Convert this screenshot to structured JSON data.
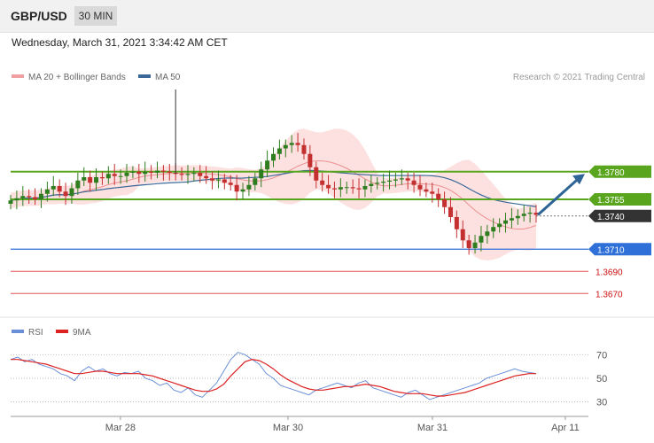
{
  "header": {
    "pair": "GBP/USD",
    "timeframe": "30 MIN",
    "datetime": "Wednesday, March 31, 2021 3:34:42 AM CET"
  },
  "legend": {
    "ma20": {
      "label": "MA 20 + Bollinger Bands",
      "color": "#f0a0a0"
    },
    "ma50": {
      "label": "MA 50",
      "color": "#3a6898"
    },
    "credit": "Research © 2021 Trading Central"
  },
  "rsi_legend": {
    "rsi": {
      "label": "RSI",
      "color": "#6a8fd8"
    },
    "ma9": {
      "label": "9MA",
      "color": "#dd2222"
    }
  },
  "colors": {
    "candle_up": "#2e7d1e",
    "candle_down": "#c43030",
    "band_fill": "#fde1e1",
    "resistance": "#5aa51e",
    "pivot": "#2e6fd8",
    "support": "#e05555",
    "arrow": "#2e6596",
    "current": "#333333"
  },
  "chart_data": [
    {
      "type": "candlestick",
      "title": "GBP/USD 30 MIN",
      "ylim": [
        1.3655,
        1.3855
      ],
      "x_ticks": [
        "Mar 28",
        "Mar 30",
        "Mar 31",
        "Apr 11"
      ],
      "x_tick_pos": [
        0.19,
        0.48,
        0.73,
        0.96
      ],
      "candles_estimated": [
        1.3754,
        1.3756,
        1.3758,
        1.3757,
        1.3755,
        1.376,
        1.3764,
        1.3767,
        1.3762,
        1.3758,
        1.3765,
        1.3772,
        1.3775,
        1.377,
        1.3775,
        1.3774,
        1.3778,
        1.3776,
        1.3776,
        1.3779,
        1.378,
        1.3778,
        1.378,
        1.3779,
        1.3781,
        1.378,
        1.3779,
        1.3778,
        1.3777,
        1.3778,
        1.3779,
        1.3776,
        1.3774,
        1.3772,
        1.3773,
        1.377,
        1.3768,
        1.3762,
        1.3764,
        1.3768,
        1.3774,
        1.3782,
        1.379,
        1.3796,
        1.3801,
        1.3804,
        1.3806,
        1.3804,
        1.3796,
        1.3784,
        1.3772,
        1.3768,
        1.3765,
        1.3764,
        1.3766,
        1.3766,
        1.3765,
        1.3764,
        1.3767,
        1.3769,
        1.377,
        1.3771,
        1.3772,
        1.3773,
        1.3774,
        1.3772,
        1.3768,
        1.3764,
        1.3762,
        1.376,
        1.3755,
        1.3748,
        1.3739,
        1.3728,
        1.3718,
        1.3711,
        1.3716,
        1.3722,
        1.3726,
        1.373,
        1.3733,
        1.3736,
        1.3738,
        1.374,
        1.3742,
        1.3743,
        1.3741
      ],
      "levels": [
        {
          "value": 1.378,
          "label": "1.3780",
          "kind": "resistance"
        },
        {
          "value": 1.3755,
          "label": "1.3755",
          "kind": "resistance"
        },
        {
          "value": 1.374,
          "label": "1.3740",
          "kind": "current"
        },
        {
          "value": 1.371,
          "label": "1.3710",
          "kind": "pivot"
        },
        {
          "value": 1.369,
          "label": "1.3690",
          "kind": "support"
        },
        {
          "value": 1.367,
          "label": "1.3670",
          "kind": "support"
        }
      ],
      "series": [
        {
          "name": "MA 20 + Bollinger Bands"
        },
        {
          "name": "MA 50"
        }
      ]
    },
    {
      "type": "line",
      "title": "RSI",
      "ylim": [
        20,
        80
      ],
      "y_ticks": [
        70,
        50,
        30
      ],
      "series": [
        {
          "name": "RSI",
          "values_estimated": [
            66,
            68,
            64,
            66,
            62,
            60,
            58,
            54,
            52,
            48,
            56,
            60,
            56,
            58,
            54,
            52,
            55,
            54,
            56,
            50,
            48,
            44,
            46,
            40,
            38,
            42,
            36,
            34,
            40,
            46,
            56,
            66,
            72,
            70,
            66,
            62,
            54,
            50,
            44,
            42,
            40,
            38,
            36,
            40,
            42,
            44,
            46,
            44,
            42,
            46,
            48,
            42,
            40,
            38,
            36,
            34,
            38,
            40,
            36,
            32,
            34,
            36,
            38,
            40,
            42,
            44,
            46,
            50,
            52,
            54,
            56,
            58,
            56,
            55,
            54
          ]
        },
        {
          "name": "9MA",
          "values_estimated": [
            66,
            66,
            65,
            64,
            63,
            62,
            60,
            58,
            56,
            54,
            54,
            55,
            56,
            56,
            55,
            54,
            54,
            54,
            54,
            53,
            52,
            50,
            48,
            46,
            44,
            42,
            40,
            39,
            39,
            41,
            45,
            52,
            58,
            64,
            66,
            65,
            62,
            58,
            53,
            49,
            46,
            43,
            41,
            40,
            40,
            41,
            42,
            43,
            43,
            44,
            45,
            44,
            43,
            41,
            39,
            38,
            37,
            37,
            37,
            36,
            35,
            35,
            36,
            37,
            38,
            40,
            42,
            44,
            46,
            48,
            50,
            52,
            53,
            54,
            54
          ]
        }
      ]
    }
  ]
}
